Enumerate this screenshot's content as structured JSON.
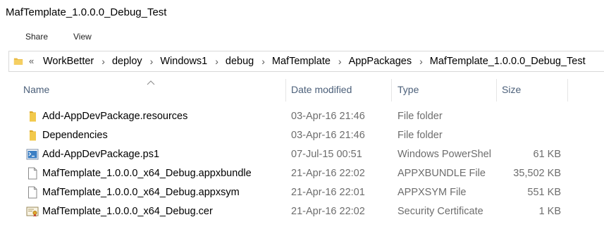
{
  "window": {
    "title": "MafTemplate_1.0.0.0_Debug_Test"
  },
  "ribbon": {
    "tabs": [
      "Share",
      "View"
    ]
  },
  "address_bar": {
    "overflow_glyph": "«",
    "separator": "›",
    "crumbs": [
      "WorkBetter",
      "deploy",
      "Windows1",
      "debug",
      "MafTemplate",
      "AppPackages",
      "MafTemplate_1.0.0.0_Debug_Test"
    ]
  },
  "columns": {
    "name": "Name",
    "date": "Date modified",
    "type": "Type",
    "size": "Size"
  },
  "files": [
    {
      "name": "Add-AppDevPackage.resources",
      "date": "03-Apr-16 21:46",
      "type": "File folder",
      "size": "",
      "icon": "folder-icon"
    },
    {
      "name": "Dependencies",
      "date": "03-Apr-16 21:46",
      "type": "File folder",
      "size": "",
      "icon": "folder-icon"
    },
    {
      "name": "Add-AppDevPackage.ps1",
      "date": "07-Jul-15 00:51",
      "type": "Windows PowerShell Script",
      "size": "61 KB",
      "icon": "powershell-script-icon"
    },
    {
      "name": "MafTemplate_1.0.0.0_x64_Debug.appxbundle",
      "date": "21-Apr-16 22:02",
      "type": "APPXBUNDLE File",
      "size": "35,502 KB",
      "icon": "file-icon"
    },
    {
      "name": "MafTemplate_1.0.0.0_x64_Debug.appxsym",
      "date": "21-Apr-16 22:01",
      "type": "APPXSYM File",
      "size": "551 KB",
      "icon": "file-icon"
    },
    {
      "name": "MafTemplate_1.0.0.0_x64_Debug.cer",
      "date": "21-Apr-16 22:02",
      "type": "Security Certificate",
      "size": "1 KB",
      "icon": "certificate-icon"
    }
  ],
  "colors": {
    "folder": "#e8b940",
    "header_text": "#4c607a",
    "detail_text": "#6d6d6d"
  }
}
